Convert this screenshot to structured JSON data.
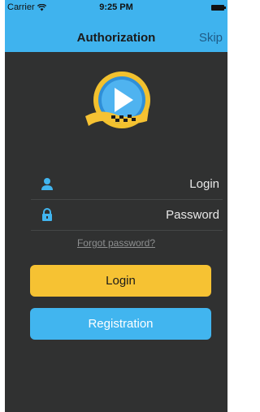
{
  "status_bar": {
    "carrier": "Carrier",
    "time": "9:25 PM"
  },
  "nav": {
    "title": "Authorization",
    "skip_label": "Skip"
  },
  "logo": {
    "icon": "play-taxi-logo-icon"
  },
  "form": {
    "login_placeholder": "Login",
    "login_value": "",
    "password_placeholder": "Password",
    "password_value": ""
  },
  "links": {
    "forgot_password": "Forgot password?"
  },
  "buttons": {
    "login": "Login",
    "registration": "Registration"
  },
  "colors": {
    "background": "#303131",
    "nav_bar": "#3fb3ee",
    "accent_yellow": "#f6c233",
    "accent_blue": "#41b5ef",
    "skip_text": "#1f5b86"
  }
}
